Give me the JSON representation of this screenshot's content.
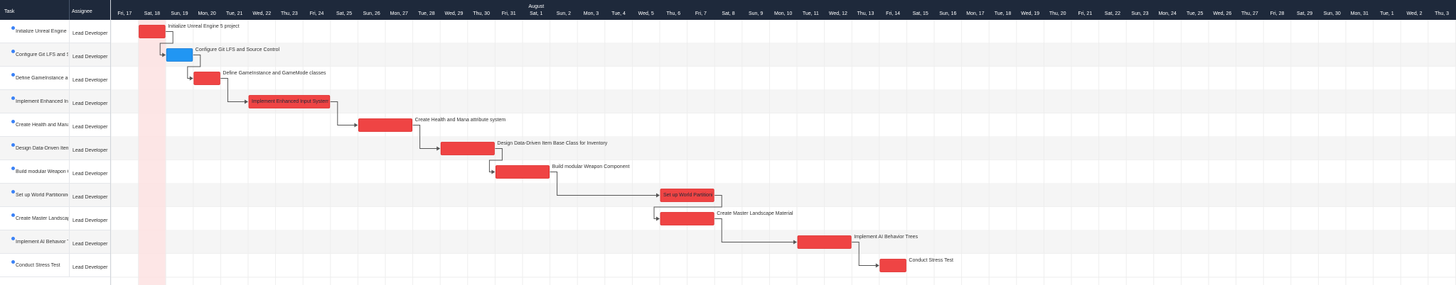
{
  "grid": {
    "columns": {
      "task": "Task",
      "assignee": "Assignee"
    },
    "rows": [
      {
        "task": "Initialize Unreal Engine 5 project",
        "assignee": "Lead Developer"
      },
      {
        "task": "Configure Git LFS and Source Control",
        "assignee": "Lead Developer"
      },
      {
        "task": "Define GameInstance and GameMode classes",
        "assignee": "Lead Developer"
      },
      {
        "task": "Implement Enhanced Input System",
        "assignee": "Lead Developer"
      },
      {
        "task": "Create Health and Mana attribute system",
        "assignee": "Lead Developer"
      },
      {
        "task": "Design Data-Driven Item Base Class for Inventory",
        "assignee": "Lead Developer"
      },
      {
        "task": "Build modular Weapon Component",
        "assignee": "Lead Developer"
      },
      {
        "task": "Set up World Partitioning",
        "assignee": "Lead Developer"
      },
      {
        "task": "Create Master Landscape Material",
        "assignee": "Lead Developer"
      },
      {
        "task": "Implement AI Behavior Trees",
        "assignee": "Lead Developer"
      },
      {
        "task": "Conduct Stress Test",
        "assignee": "Lead Developer"
      }
    ]
  },
  "scale": {
    "month_label": "August",
    "month_start_index": 15,
    "today_index": 1,
    "days": [
      "Fri, 17",
      "Sat, 18",
      "Sun, 19",
      "Mon, 20",
      "Tue, 21",
      "Wed, 22",
      "Thu, 23",
      "Fri, 24",
      "Sat, 25",
      "Sun, 26",
      "Mon, 27",
      "Tue, 28",
      "Wed, 29",
      "Thu, 30",
      "Fri, 31",
      "Sat, 1",
      "Sun, 2",
      "Mon, 3",
      "Tue, 4",
      "Wed, 5",
      "Thu, 6",
      "Fri, 7",
      "Sat, 8",
      "Sun, 9",
      "Mon, 10",
      "Tue, 11",
      "Wed, 12",
      "Thu, 13",
      "Fri, 14",
      "Sat, 15",
      "Sun, 16",
      "Mon, 17",
      "Tue, 18",
      "Wed, 19",
      "Thu, 20",
      "Fri, 21",
      "Sat, 22",
      "Sun, 23",
      "Mon, 24",
      "Tue, 25",
      "Wed, 26",
      "Thu, 27",
      "Fri, 28",
      "Sat, 29",
      "Sun, 30",
      "Mon, 31",
      "Tue, 1",
      "Wed, 2",
      "Thu, 3"
    ]
  },
  "tasks": [
    {
      "id": 1,
      "start": 1,
      "duration": 1,
      "label_side": "right",
      "selected": false
    },
    {
      "id": 2,
      "start": 2,
      "duration": 1,
      "label_side": "right",
      "selected": true
    },
    {
      "id": 3,
      "start": 3,
      "duration": 1,
      "label_side": "right",
      "selected": false
    },
    {
      "id": 4,
      "start": 5,
      "duration": 3,
      "label_side": "inside",
      "selected": false
    },
    {
      "id": 5,
      "start": 9,
      "duration": 2,
      "label_side": "right",
      "selected": false
    },
    {
      "id": 6,
      "start": 12,
      "duration": 2,
      "label_side": "right",
      "selected": false
    },
    {
      "id": 7,
      "start": 14,
      "duration": 2,
      "label_side": "right",
      "selected": false
    },
    {
      "id": 8,
      "start": 20,
      "duration": 2,
      "label_side": "inside",
      "selected": false
    },
    {
      "id": 9,
      "start": 20,
      "duration": 2,
      "label_side": "right",
      "selected": false
    },
    {
      "id": 10,
      "start": 25,
      "duration": 2,
      "label_side": "right",
      "selected": false
    },
    {
      "id": 11,
      "start": 28,
      "duration": 1,
      "label_side": "right",
      "selected": false
    }
  ],
  "links": [
    [
      1,
      2
    ],
    [
      2,
      3
    ],
    [
      3,
      4
    ],
    [
      4,
      5
    ],
    [
      5,
      6
    ],
    [
      6,
      7
    ],
    [
      7,
      8
    ],
    [
      8,
      9
    ],
    [
      9,
      10
    ],
    [
      10,
      11
    ]
  ],
  "colors": {
    "header_bg": "#1e293b",
    "task_bar": "#ef4444",
    "task_bar_border": "#dc2626",
    "selected_bar": "#2196f3",
    "today_column": "#fde2e2",
    "row_alt": "#f5f5f5",
    "link_line": "#555555",
    "dot": "#3b82f6"
  }
}
